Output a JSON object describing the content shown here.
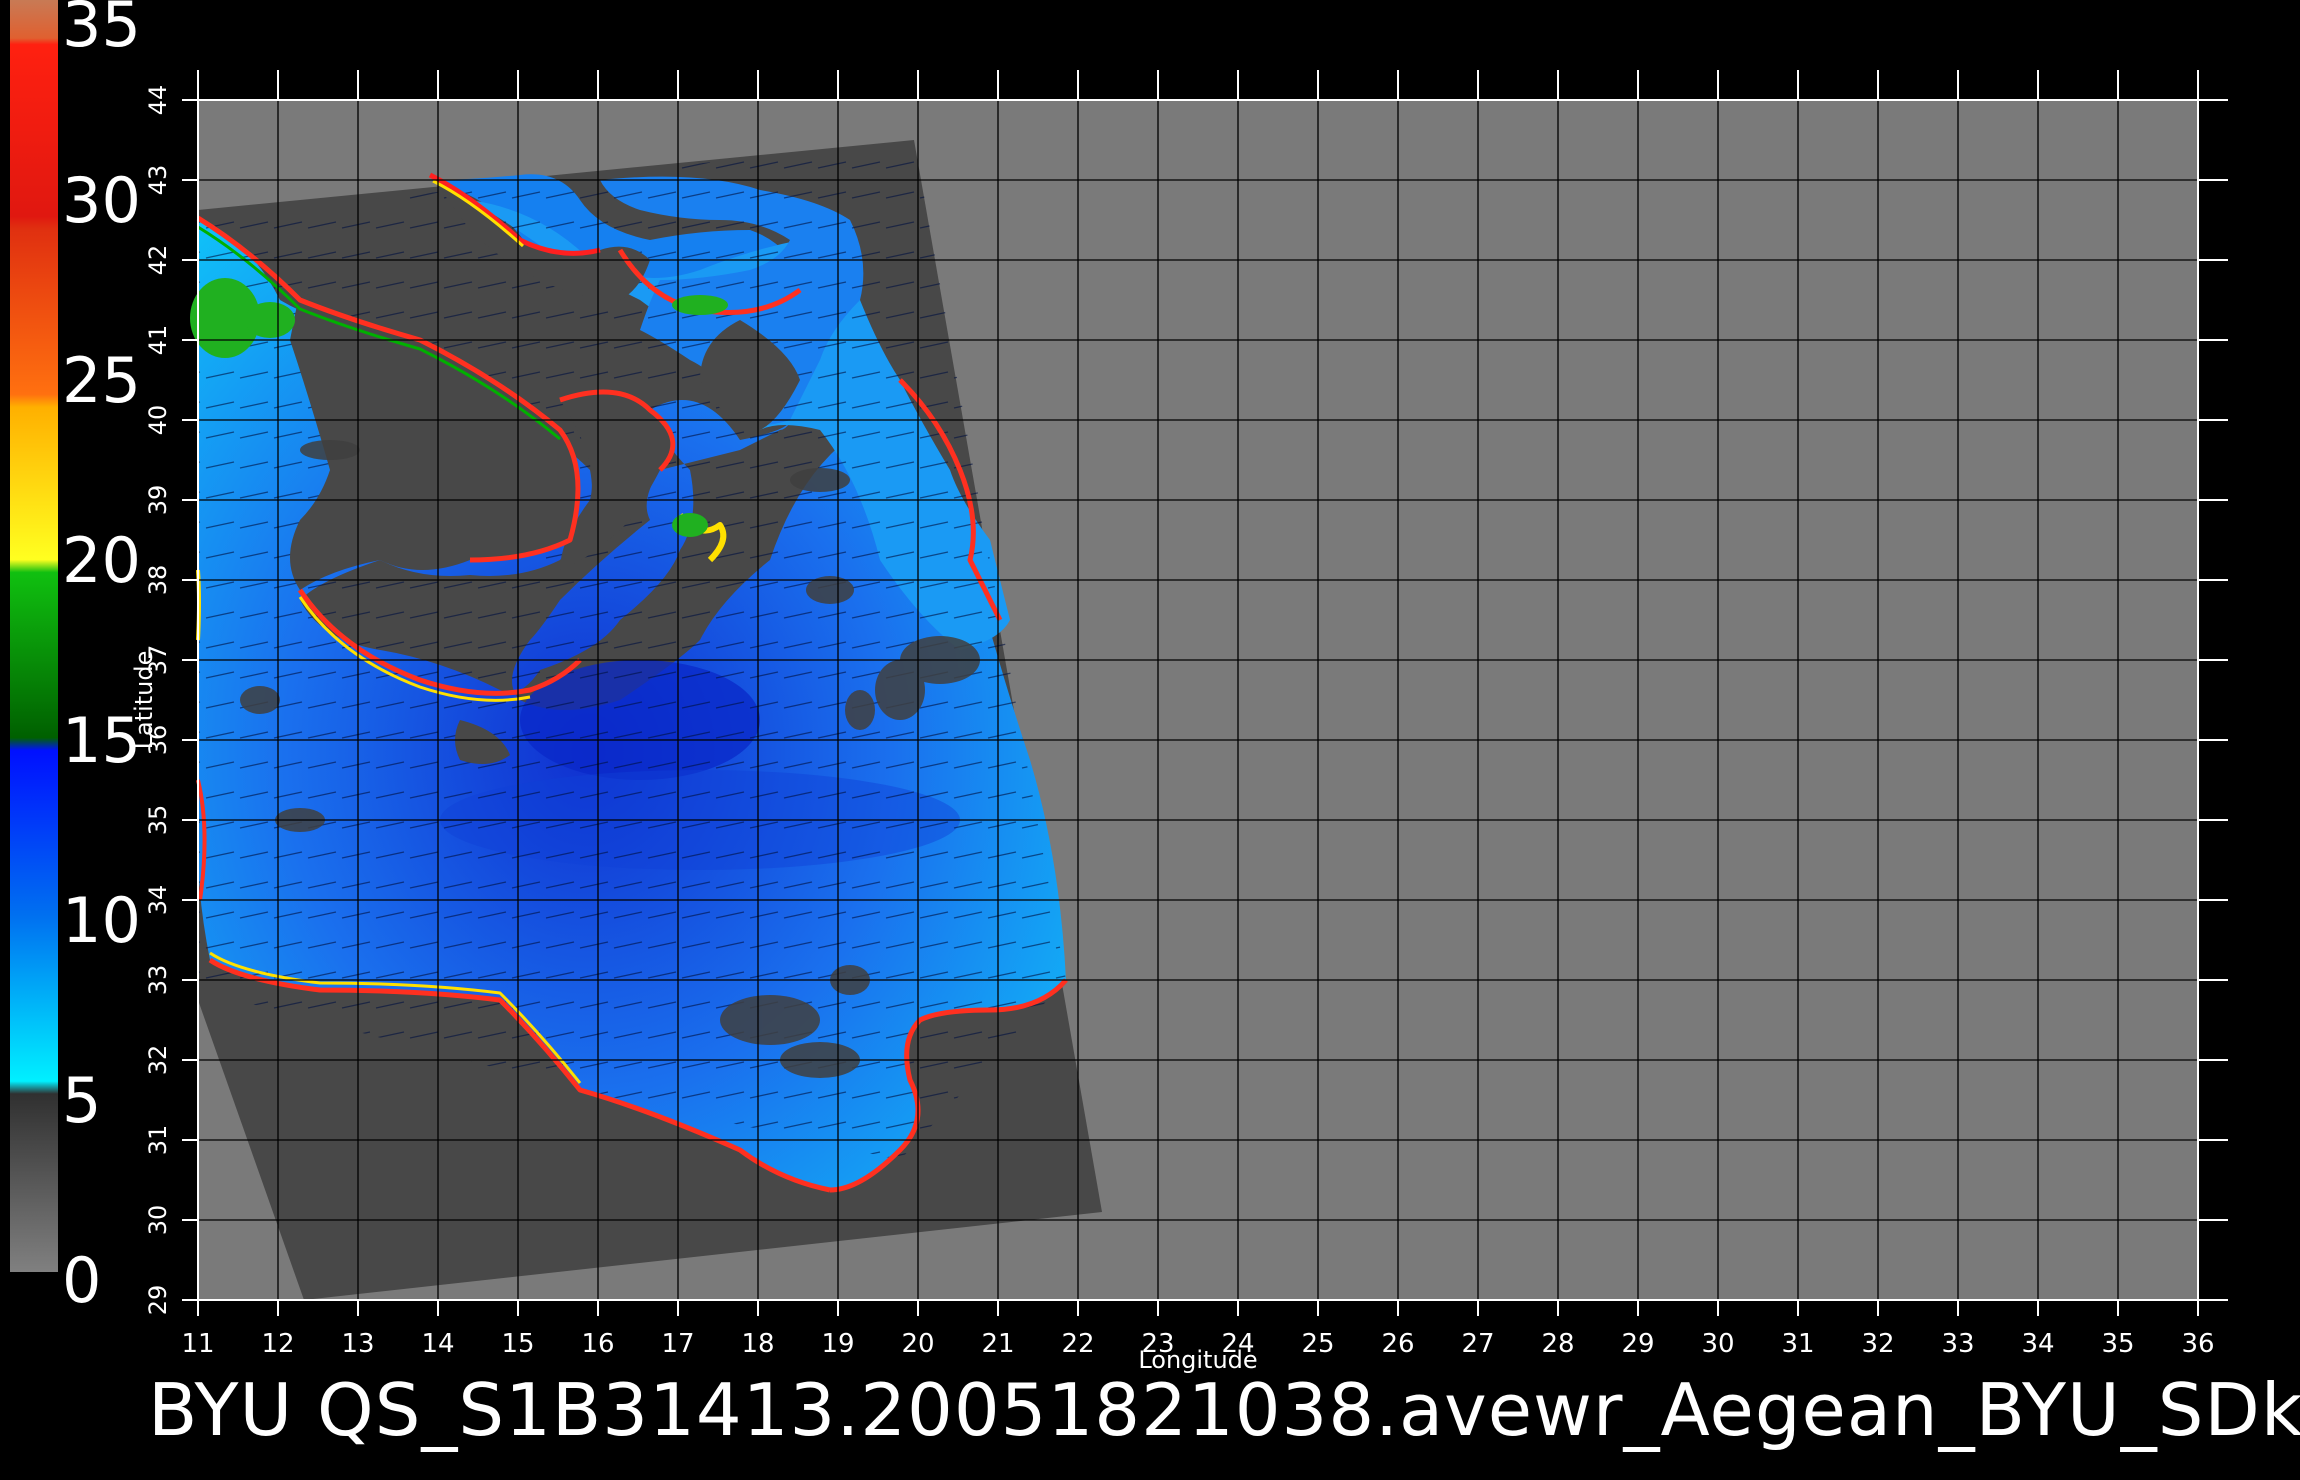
{
  "colorbar": {
    "labels": [
      "35",
      "30",
      "25",
      "20",
      "15",
      "10",
      "5",
      "0"
    ],
    "segments": [
      {
        "color": "#c87a55"
      },
      {
        "color": "#ff2010"
      },
      {
        "color": "#ff6a10"
      },
      {
        "color": "#ffd800"
      },
      {
        "color": "#00a000"
      },
      {
        "color": "#0050f0"
      },
      {
        "color": "#00c8ff"
      },
      {
        "color": "#505050"
      }
    ]
  },
  "axes": {
    "xlabel": "Longitude",
    "ylabel": "Latitude",
    "lon_ticks": [
      "11",
      "12",
      "13",
      "14",
      "15",
      "16",
      "17",
      "18",
      "19",
      "20",
      "21",
      "22",
      "23",
      "24",
      "25",
      "26",
      "27",
      "28",
      "29",
      "30",
      "31",
      "32",
      "33",
      "34",
      "35",
      "36"
    ],
    "lat_ticks": [
      "29",
      "30",
      "31",
      "32",
      "33",
      "34",
      "35",
      "36",
      "37",
      "38",
      "39",
      "40",
      "41",
      "42",
      "43",
      "44"
    ]
  },
  "title": "BYU  QS_S1B31413.20051821038.avewr_Aegean_BYU_SDk"
}
